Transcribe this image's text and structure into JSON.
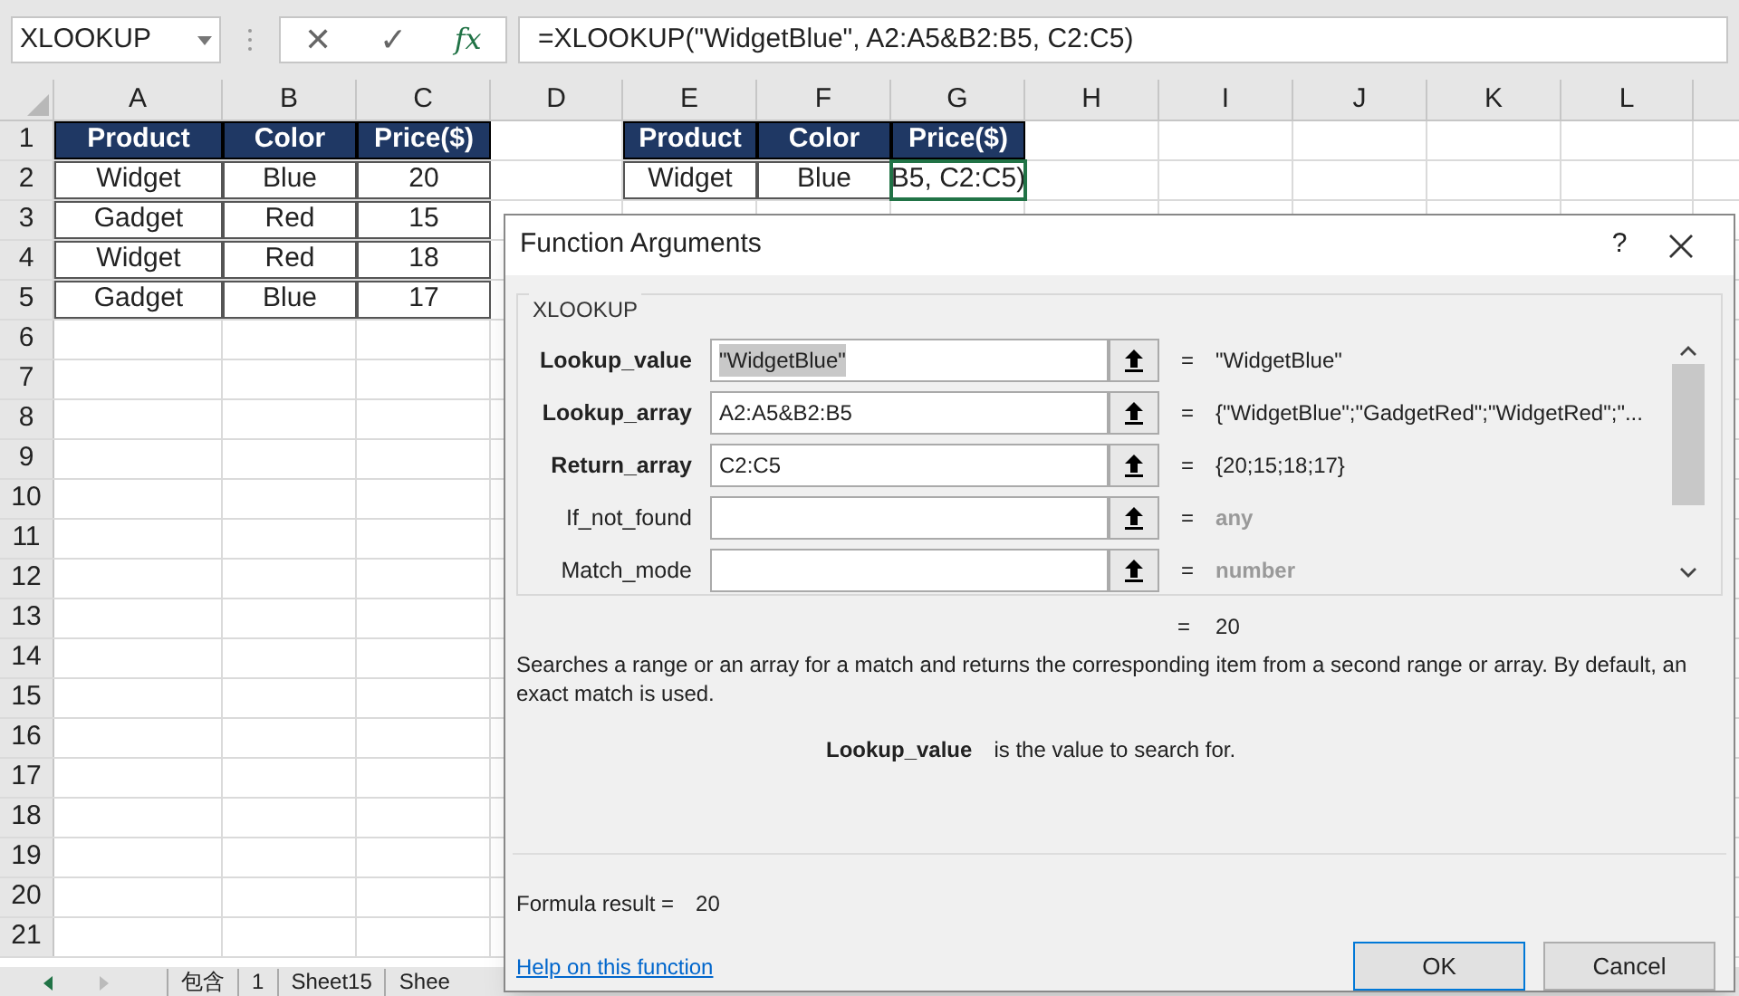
{
  "name_box": "XLOOKUP",
  "formula_bar": {
    "cancel": "✕",
    "enter": "✓",
    "function_button": "fx",
    "formula": "=XLOOKUP(\"WidgetBlue\", A2:A5&B2:B5, C2:C5)"
  },
  "columns": [
    "A",
    "B",
    "C",
    "D",
    "E",
    "F",
    "G",
    "H",
    "I",
    "J",
    "K",
    "L"
  ],
  "rows": [
    {
      "number": "1",
      "cells": [
        {
          "text": "Product",
          "kind": "header",
          "selected": false
        },
        {
          "text": "Color",
          "kind": "header",
          "selected": false
        },
        {
          "text": "Price($)",
          "kind": "header",
          "selected": false
        },
        null,
        {
          "text": "Product",
          "kind": "header",
          "selected": false
        },
        {
          "text": "Color",
          "kind": "header",
          "selected": false
        },
        {
          "text": "Price($)",
          "kind": "header",
          "selected": false
        },
        null,
        null,
        null,
        null,
        null
      ]
    },
    {
      "number": "2",
      "cells": [
        {
          "text": "Widget",
          "kind": "data",
          "selected": false
        },
        {
          "text": "Blue",
          "kind": "data",
          "selected": false
        },
        {
          "text": "20",
          "kind": "data",
          "selected": false
        },
        null,
        {
          "text": "Widget",
          "kind": "data",
          "selected": false
        },
        {
          "text": "Blue",
          "kind": "data",
          "selected": false
        },
        {
          "text": "B5, C2:C5)",
          "kind": "data",
          "selected": true
        },
        null,
        null,
        null,
        null,
        null
      ]
    },
    {
      "number": "3",
      "cells": [
        {
          "text": "Gadget",
          "kind": "data",
          "selected": false
        },
        {
          "text": "Red",
          "kind": "data",
          "selected": false
        },
        {
          "text": "15",
          "kind": "data",
          "selected": false
        }
      ]
    },
    {
      "number": "4",
      "cells": [
        {
          "text": "Widget",
          "kind": "data",
          "selected": false
        },
        {
          "text": "Red",
          "kind": "data",
          "selected": false
        },
        {
          "text": "18",
          "kind": "data",
          "selected": false
        }
      ]
    },
    {
      "number": "5",
      "cells": [
        {
          "text": "Gadget",
          "kind": "data",
          "selected": false
        },
        {
          "text": "Blue",
          "kind": "data",
          "selected": false
        },
        {
          "text": "17",
          "kind": "data",
          "selected": false
        }
      ]
    },
    {
      "number": "6",
      "cells": []
    },
    {
      "number": "7",
      "cells": []
    },
    {
      "number": "8",
      "cells": []
    },
    {
      "number": "9",
      "cells": []
    },
    {
      "number": "10",
      "cells": []
    },
    {
      "number": "11",
      "cells": []
    },
    {
      "number": "12",
      "cells": []
    },
    {
      "number": "13",
      "cells": []
    },
    {
      "number": "14",
      "cells": []
    },
    {
      "number": "15",
      "cells": []
    },
    {
      "number": "16",
      "cells": []
    },
    {
      "number": "17",
      "cells": []
    },
    {
      "number": "18",
      "cells": []
    },
    {
      "number": "19",
      "cells": []
    },
    {
      "number": "20",
      "cells": []
    },
    {
      "number": "21",
      "cells": []
    }
  ],
  "sheet_tabs": [
    {
      "label": "包含",
      "selected": false
    },
    {
      "label": "1",
      "selected": false
    },
    {
      "label": "Sheet15",
      "selected": false
    },
    {
      "label": "Shee",
      "selected": false
    }
  ],
  "dialog": {
    "title": "Function Arguments",
    "help_button": "?",
    "function_name": "XLOOKUP",
    "arguments": [
      {
        "label": "Lookup_value",
        "required": true,
        "value": "\"WidgetBlue\"",
        "value_selected": true,
        "equals": "=",
        "result": "\"WidgetBlue\"",
        "result_muted": false
      },
      {
        "label": "Lookup_array",
        "required": true,
        "value": "A2:A5&B2:B5",
        "value_selected": false,
        "equals": "=",
        "result": "{\"WidgetBlue\";\"GadgetRed\";\"WidgetRed\";\"...",
        "result_muted": false
      },
      {
        "label": "Return_array",
        "required": true,
        "value": "C2:C5",
        "value_selected": false,
        "equals": "=",
        "result": "{20;15;18;17}",
        "result_muted": false
      },
      {
        "label": "If_not_found",
        "required": false,
        "equals": "=",
        "result": "any",
        "result_muted": true
      },
      {
        "label": "Match_mode",
        "required": false,
        "equals": "=",
        "result": "number",
        "result_muted": true
      }
    ],
    "function_equals": "=",
    "function_result": "20",
    "description": "Searches a range or an array for a match and returns the corresponding item from a second range or array. By default, an exact match is used.",
    "argument_name": "Lookup_value",
    "argument_help": "is the value to search for.",
    "formula_result_label": "Formula result =",
    "formula_result": "20",
    "help_link": "Help on this function",
    "ok": "OK",
    "cancel": "Cancel"
  }
}
